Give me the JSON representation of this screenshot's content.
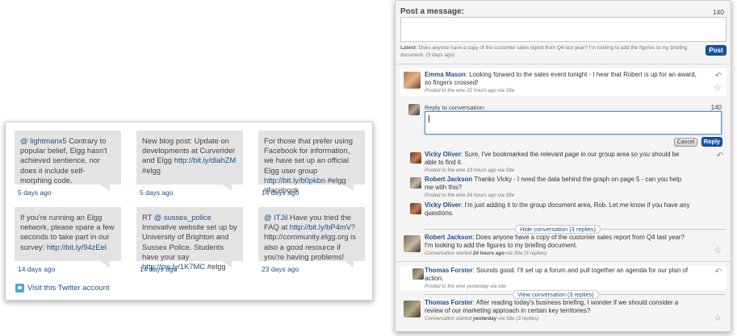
{
  "twitter": {
    "tweets": [
      {
        "mention": "@ lightmanx5",
        "text": " Contrary to popular belief, Elgg hasn't achieved sentience, nor does it include self-morphing code.",
        "link": "",
        "text_after": "",
        "date": "5 days ago"
      },
      {
        "mention": "",
        "text": "New blog post: Update on developments at Curverider and Elgg ",
        "link": "http://bit.ly/dlahZM",
        "text_after": " #elgg",
        "date": "5 days ago"
      },
      {
        "mention": "",
        "text": "For those that prefer using Facebook for information, we have set up an official Elgg user group ",
        "link": "http://bit.ly/b0pkbn",
        "text_after": " #elgg #facebook",
        "date": "14 days ago"
      },
      {
        "mention": "",
        "text": "If you're running an Elgg network, please spare a few seconds to take part in our survey: ",
        "link": "http://bit.ly/94zEel",
        "text_after": "",
        "date": "14 days ago"
      },
      {
        "mention": "RT @ sussex_police",
        "text": " Innovative website set up by University of Brighton and Sussex Police. Students have your say ",
        "link": "http://ow.ly/1K7MC",
        "text_after": " #elgg",
        "date": "14 days ago"
      },
      {
        "mention": "@ ITJil",
        "text": " Have you tried the FAQ at ",
        "link": "http://bit.ly/bP4mV?",
        "text_after": " http://community.elgg.org is also a good resource if you're having problems!",
        "date": "23 days ago"
      }
    ],
    "footer": "Visit this Twitter account"
  },
  "wire": {
    "post_title": "Post a message:",
    "char_count": "140",
    "latest_label": "Latest:",
    "latest_text": " Does anyone have a copy of the customer sales report from Q4 last year? I'm looking to add the figures to my briefing document.",
    "latest_time": " (3 days ago)",
    "post_button": "Post",
    "emma": {
      "name": "Emma Mason",
      "text": ": Looking forward to the sales event tonight - I hear that Robert is up for an award, so fingers crossed!",
      "meta": "Posted to the wire 22 hours ago via Site"
    },
    "reply_label": "Reply to conversation:",
    "reply_count": "140",
    "cancel_button": "Cancel",
    "reply_button": "Reply",
    "thread": [
      {
        "name": "Vicky Oliver",
        "text": ": Sure, I've bookmarked the relevant page in our group area so you should be able to find it.",
        "meta": "Posted to the wire 23 hours ago via Site"
      },
      {
        "name": "Robert Jackson",
        "text": " Thanks Vicky - I need the data behind the graph on page 5 - can you help me with this?",
        "meta": "Posted to the wire 24 hours ago via Site"
      },
      {
        "name": "Vicky Oliver",
        "text": ": I'm just adding it to the group document area, Rob. Let me know if you have any questions.",
        "meta": "Posted to the wire 24 hours ago via Site"
      }
    ],
    "hide_conversation": "Hide conversation (3 replies)",
    "robert": {
      "name": "Robert Jackson",
      "text": ": Does anyone have a copy of the customer sales report from Q4 last year? I'm looking to add the figures to my briefing document.",
      "meta_prefix": "Conversation started ",
      "meta_time": "24 hours ago",
      "meta_suffix": " via Site (3 replies)"
    },
    "thomas1": {
      "name": "Thomas Forster",
      "text": ": Sounds good. I'll set up a forum and pull together an agenda for our plan of action.",
      "meta": "Posted to the wire yesterday via site"
    },
    "view_conversation": "View conversation (3 replies)",
    "thomas2": {
      "name": "Thomas Forster",
      "text": ": After reading today's business briefing, I wonder if we should consider a review of our marketing approach in certain key territories?",
      "meta_prefix": "Conversation started ",
      "meta_time": "yesterday",
      "meta_suffix": " via Site (3 replies)"
    }
  }
}
